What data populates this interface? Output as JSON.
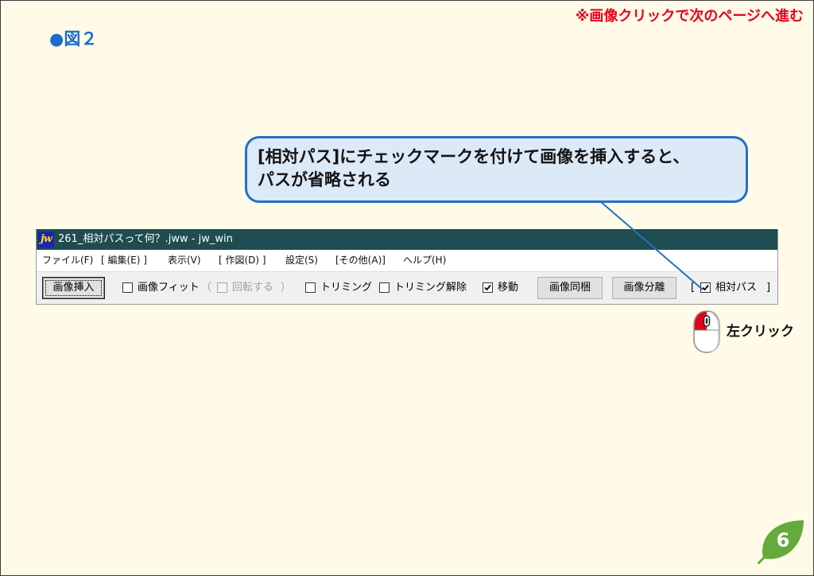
{
  "slide": {
    "nav_hint": "※画像クリックで次のページへ進む",
    "figure_label": "●図２"
  },
  "callout": {
    "lines": [
      "[相対パス]にチェックマークを付けて画像を挿入すると、",
      "パスが省略される"
    ]
  },
  "app_window": {
    "icon_text": "jw",
    "title": "261_相対パスって何？.jww - jw_win",
    "menu": [
      "ファイル(F)",
      "[ 編集(E) ]",
      "表示(V)",
      "[ 作図(D) ]",
      "設定(S)",
      "[その他(A)]",
      "ヘルプ(H)"
    ],
    "toolbar": {
      "insert_button": "画像挿入",
      "fit": {
        "label": "画像フィット",
        "checked": false
      },
      "rotate_group_open": "（",
      "rotate": {
        "label": "回転する",
        "checked": false,
        "enabled": false
      },
      "rotate_group_close": "）",
      "trim": {
        "label": "トリミング",
        "checked": false
      },
      "trim_release": {
        "label": "トリミング解除",
        "checked": false
      },
      "move": {
        "label": "移動",
        "checked": true
      },
      "bundle_button": "画像同梱",
      "separate_button": "画像分離",
      "relative_group_open": "[",
      "relative_path": {
        "label": "相対パス",
        "checked": true
      },
      "relative_group_close": "]"
    }
  },
  "mouse_hint": {
    "label": "左クリック"
  },
  "page_number": "6",
  "icons": {
    "app": "jw-app-icon",
    "checkmark": "checkmark-icon",
    "mouse": "mouse-left-click-icon",
    "page_badge": "leaf-icon"
  },
  "colors": {
    "page_bg": "#FFFBE8",
    "nav_hint": "#E8001C",
    "figure_label": "#1C6DC9",
    "callout_fill": "#DCE9F7",
    "callout_border": "#2371C4",
    "pointer_line": "#2371C4",
    "title_bar": "#1F4C50",
    "page_badge": "#64AA3C",
    "mouse_button": "#E3001B"
  }
}
